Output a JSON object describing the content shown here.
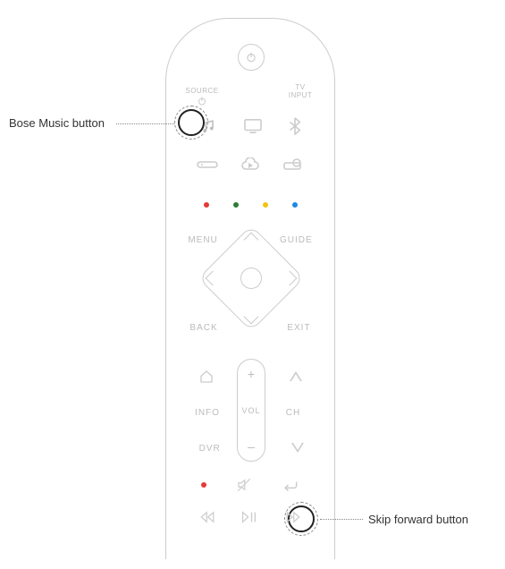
{
  "callouts": {
    "music": "Bose Music button",
    "skip": "Skip forward button"
  },
  "labels": {
    "source": "SOURCE",
    "tv_input": "TV\nINPUT",
    "menu": "MENU",
    "guide": "GUIDE",
    "back": "BACK",
    "exit": "EXIT",
    "info": "INFO",
    "dvr": "DVR",
    "vol": "VOL",
    "ch": "CH"
  },
  "icons": {
    "power": "power-icon",
    "source_power": "source-power-icon",
    "music": "music-note-icon",
    "tv": "tv-icon",
    "bluetooth": "bluetooth-icon",
    "soundbar": "soundbar-icon",
    "cloud": "cloud-play-icon",
    "projector": "projector-icon",
    "home": "home-icon",
    "mute": "mute-icon",
    "return": "return-icon",
    "prev": "skip-back-icon",
    "playpause": "play-pause-icon",
    "next": "skip-forward-icon"
  },
  "color_dots": [
    "#e53935",
    "#2e7d32",
    "#f1c40f",
    "#1e88e5"
  ],
  "vol": {
    "plus": "+",
    "minus": "–"
  }
}
